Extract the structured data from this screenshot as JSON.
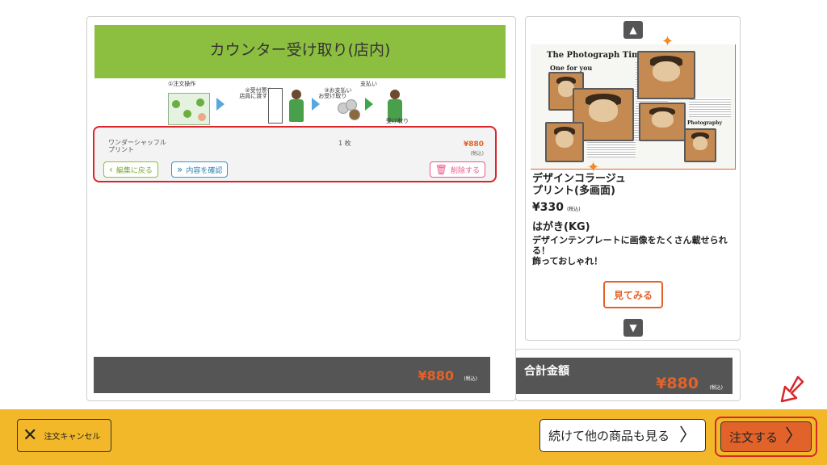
{
  "order": {
    "banner_title": "カウンター受け取り(店内)",
    "steps": [
      {
        "label": "①注文操作"
      },
      {
        "label": "②受付票を\n店員に渡す"
      },
      {
        "label": "③お支払い\nお受け取り"
      },
      {
        "label": "支払い"
      },
      {
        "label": "受け取り"
      }
    ],
    "item": {
      "name": "ワンダーシャッフル\nプリント",
      "quantity": "1 枚",
      "price": "¥880",
      "tax_note": "(税込)",
      "back_label": "編集に戻る",
      "check_label": "内容を確認",
      "delete_label": "削除する"
    },
    "subtotal": {
      "amount": "¥880",
      "tax_note": "(税込)"
    }
  },
  "recommendation": {
    "collage_title": "The Photograph Times",
    "collage_subtitle": "One for you",
    "collage_caption": "Photography",
    "name": "デザインコラージュ\nプリント(多画面)",
    "price": "¥330",
    "price_tax": "(税込)",
    "size": "はがき(KG)",
    "description": "デザインテンプレートに画像をたくさん載せられる！\n飾っておしゃれ！",
    "view_label": "見てみる"
  },
  "total": {
    "label": "合計金額",
    "amount": "¥880",
    "tax_note": "(税込)"
  },
  "footer": {
    "cancel_label": "注文キャンセル",
    "continue_label": "続けて他の商品も見る",
    "order_label": "注文する"
  },
  "colors": {
    "accent_orange": "#e2632a",
    "banner_green": "#8cbf3f",
    "footer_yellow": "#f2b829",
    "highlight_red": "#d9262a"
  },
  "icons": [
    "close-icon",
    "chevron-right-icon",
    "chevron-left-icon",
    "double-chevron-icon",
    "trash-icon",
    "arrow-up-icon",
    "arrow-down-icon",
    "pointer-arrow-icon"
  ]
}
